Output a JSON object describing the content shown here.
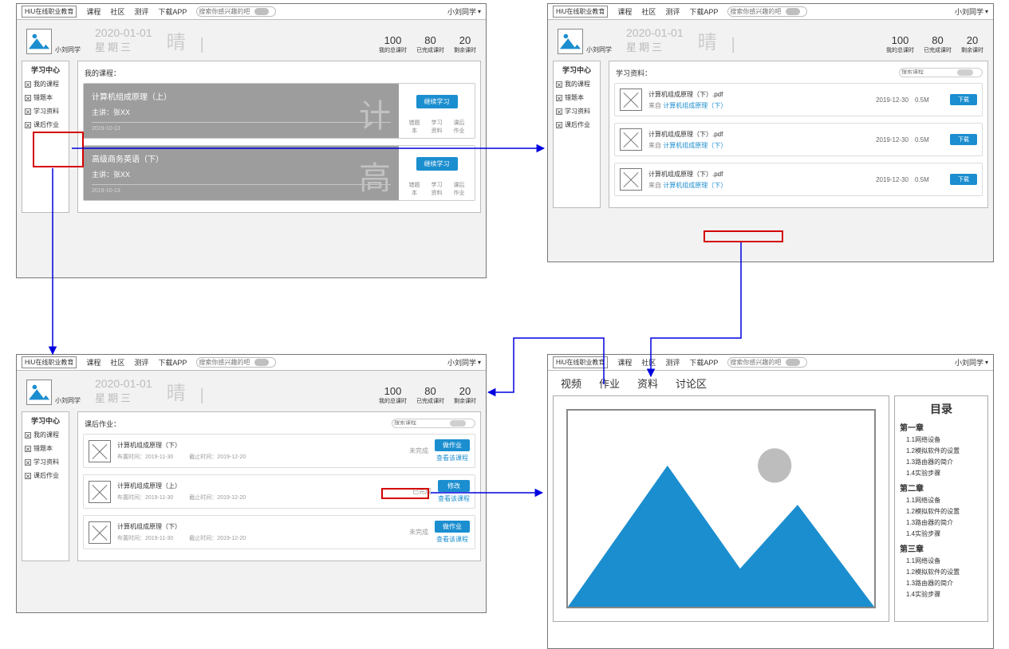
{
  "nav": {
    "brand": "HiU在线职业教育",
    "links": [
      "课程",
      "社区",
      "测评",
      "下载APP"
    ],
    "search_placeholder": "搜索你感兴趣的吧",
    "user": "小刘同学",
    "chev": "▾"
  },
  "header": {
    "username": "小刘同学",
    "date": "2020-01-01",
    "weekday": "星期三",
    "weather": "晴",
    "stats": [
      {
        "n": "100",
        "t": "我的总课时"
      },
      {
        "n": "80",
        "t": "已完成课时"
      },
      {
        "n": "20",
        "t": "剩余课时"
      }
    ]
  },
  "sidebar": {
    "title": "学习中心",
    "items": [
      "我的课程",
      "错题本",
      "学习资料",
      "课后作业"
    ]
  },
  "s1": {
    "title": "我的课程：",
    "courses": [
      {
        "name": "计算机组成原理（上）",
        "teacher": "主讲：张XX",
        "date": "2019-10-13",
        "glyph": "计"
      },
      {
        "name": "高级商务英语（下）",
        "teacher": "主讲：张XX",
        "date": "2019-10-13",
        "glyph": "高"
      }
    ],
    "btn": "继续学习",
    "mini": [
      "错题本",
      "学习资料",
      "课后作业"
    ],
    "mini_l1": [
      "错题",
      "学习",
      "课后"
    ],
    "mini_l2": [
      "本",
      "资料",
      "作业"
    ]
  },
  "s2": {
    "title": "学习资料：",
    "search_placeholder": "搜索课程",
    "rows": [
      {
        "name": "计算机组成原理（下）.pdf",
        "from_course": "计算机组成原理（下）",
        "date": "2019-12-30",
        "size": "0.5M"
      },
      {
        "name": "计算机组成原理（下）.pdf",
        "from_course": "计算机组成原理（下）",
        "date": "2019-12-30",
        "size": "0.5M"
      },
      {
        "name": "计算机组成原理（下）.pdf",
        "from_course": "计算机组成原理（下）",
        "date": "2019-12-30",
        "size": "0.5M"
      }
    ],
    "from_label": "来自",
    "dl": "下载"
  },
  "s3": {
    "title": "课后作业：",
    "search_placeholder": "搜索课程",
    "rows": [
      {
        "name": "计算机组成原理（下）",
        "assign": "布置时间：2019-11-30",
        "due": "截止时间：2019-12-20",
        "status": "未完成",
        "btn": "做作业"
      },
      {
        "name": "计算机组成原理（上）",
        "assign": "布置时间：2019-11-30",
        "due": "截止时间：2019-12-20",
        "status": "已完成",
        "btn": "修改"
      },
      {
        "name": "计算机组成原理（下）",
        "assign": "布置时间：2019-11-30",
        "due": "截止时间：2019-12-20",
        "status": "未完成",
        "btn": "做作业"
      }
    ],
    "view": "查看该课程"
  },
  "s4": {
    "tabs": [
      "视频",
      "作业",
      "资料",
      "讨论区"
    ],
    "toc_title": "目录",
    "chapters": [
      {
        "title": "第一章",
        "items": [
          "1.1网络设备",
          "1.2模拟软件的设置",
          "1.3路由器的简介",
          "1.4实验步骤"
        ]
      },
      {
        "title": "第二章",
        "items": [
          "1.1网络设备",
          "1.2模拟软件的设置",
          "1.3路由器的简介",
          "1.4实验步骤"
        ]
      },
      {
        "title": "第三章",
        "items": [
          "1.1网络设备",
          "1.2模拟软件的设置",
          "1.3路由器的简介",
          "1.4实验步骤"
        ]
      }
    ]
  }
}
